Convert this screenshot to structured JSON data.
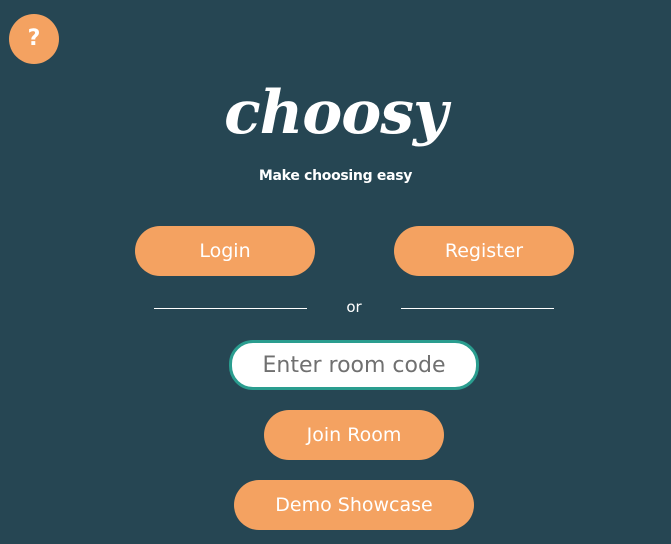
{
  "help": {
    "icon": "question-mark-icon",
    "glyph": "?"
  },
  "brand": {
    "logo": "choosy",
    "tagline": "Make choosing easy"
  },
  "auth": {
    "login_label": "Login",
    "register_label": "Register"
  },
  "divider": {
    "text": "or"
  },
  "room": {
    "placeholder": "Enter room code",
    "value": ""
  },
  "actions": {
    "join_label": "Join Room",
    "demo_label": "Demo Showcase"
  },
  "colors": {
    "background": "#264653",
    "accent": "#f4a261",
    "input_border": "#2a9d8f",
    "text": "#ffffff"
  }
}
